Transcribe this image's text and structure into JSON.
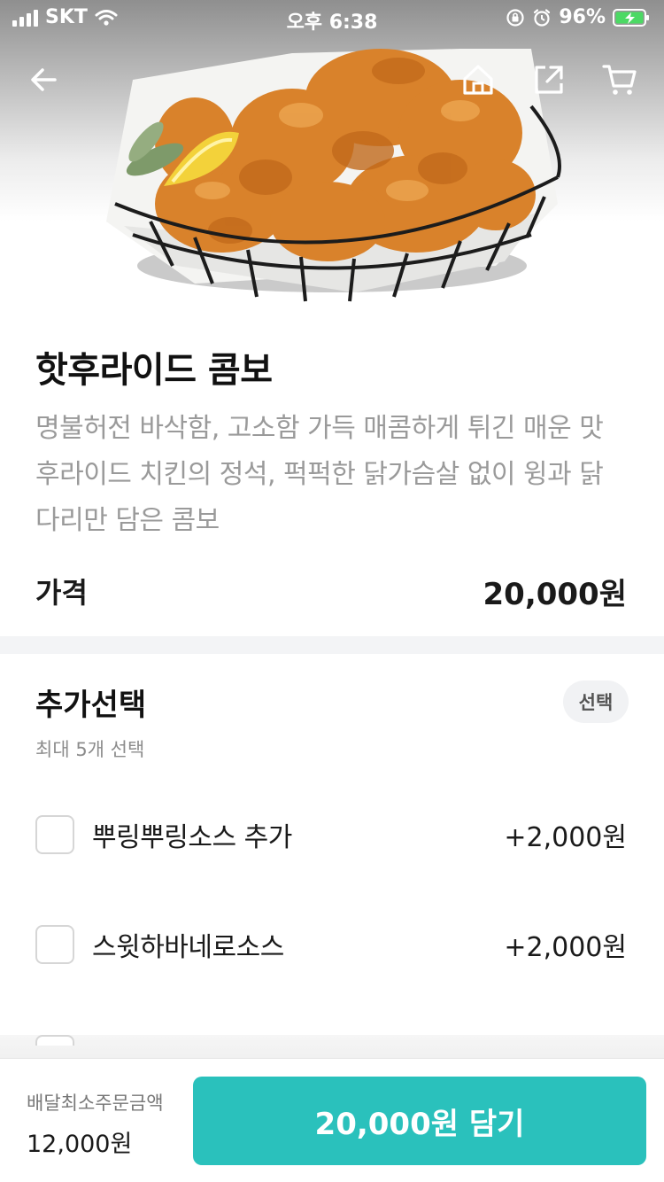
{
  "status_bar": {
    "carrier": "SKT",
    "time": "오후 6:38",
    "battery": "96%",
    "icons": [
      "signal-icon",
      "wifi-icon",
      "orientation-lock-icon",
      "alarm-icon",
      "battery-charging-icon"
    ]
  },
  "nav": {
    "icons": [
      "back-arrow-icon",
      "home-icon",
      "share-icon",
      "cart-icon"
    ]
  },
  "product": {
    "title": "핫후라이드 콤보",
    "description_lines": [
      "명불허전 바삭함, 고소함 가득 매콤하게 튀긴 매운 맛",
      "후라이드 치킨의 정석, 퍽퍽한 닭가슴살 없이 윙과 닭",
      "다리만 담은 콤보"
    ],
    "price_label": "가격",
    "price": "20,000원"
  },
  "options": {
    "title": "추가선택",
    "badge": "선택",
    "subtitle": "최대 5개 선택",
    "items": [
      {
        "label": "뿌링뿌링소스 추가",
        "price": "+2,000원",
        "checked": false
      },
      {
        "label": "스윗하바네로소스",
        "price": "+2,000원",
        "checked": false
      }
    ]
  },
  "bottom_bar": {
    "min_order_label": "배달최소주문금액",
    "min_order_value": "12,000원",
    "add_button": "20,000원 담기"
  },
  "colors": {
    "accent": "#2ac1bc",
    "text_primary": "#1a1a1a",
    "text_secondary": "#9a9a9a",
    "divider": "#f3f4f6"
  }
}
